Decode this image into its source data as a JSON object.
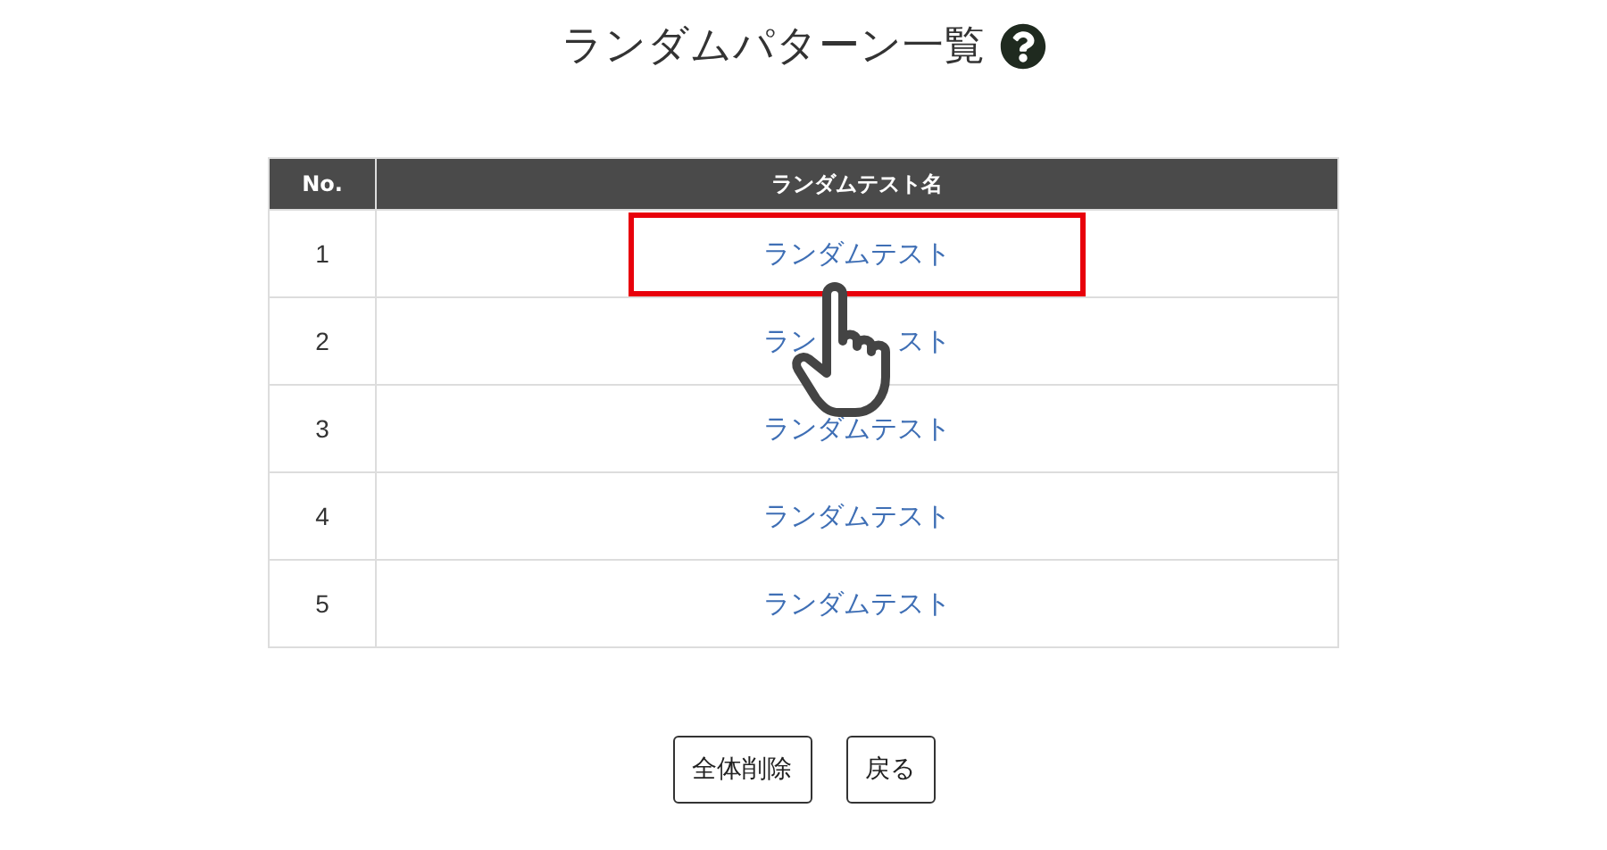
{
  "title": "ランダムパターン一覧",
  "table": {
    "columns": [
      "No.",
      "ランダムテスト名"
    ],
    "rows": [
      {
        "no": "1",
        "name": "ランダムテスト",
        "highlighted": true
      },
      {
        "no": "2",
        "name": "ラン",
        "name_tail": "スト",
        "highlighted": false
      },
      {
        "no": "3",
        "name": "ランダムテスト",
        "highlighted": false
      },
      {
        "no": "4",
        "name": "ランダムテスト",
        "highlighted": false
      },
      {
        "no": "5",
        "name": "ランダムテスト",
        "highlighted": false
      }
    ]
  },
  "buttons": [
    "全体削除",
    "戻る"
  ]
}
